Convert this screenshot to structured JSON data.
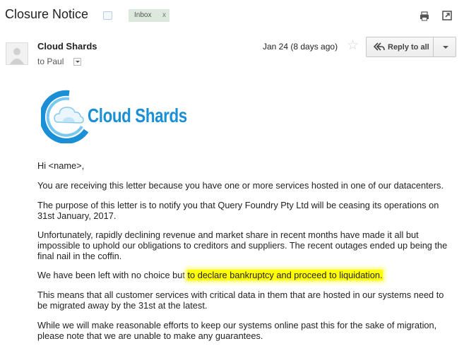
{
  "subject": "Closure Notice",
  "labels": {
    "inbox": "Inbox",
    "remove": "x"
  },
  "sender": {
    "name": "Cloud Shards",
    "to": "to Paul"
  },
  "date": "Jan 24 (8 days ago)",
  "star": "☆",
  "actions": {
    "reply_all": "Reply to all"
  },
  "logo": {
    "text": "Cloud Shards",
    "accent_color": "#1a8fd6"
  },
  "body": {
    "greeting": "Hi <name>,",
    "p1": "You are receiving this letter because you have one or more services hosted in one of our datacenters.",
    "p2": "The purpose of this letter is to notify you that Query Foundry Pty Ltd will be ceasing its operations on 31st January, 2017.",
    "p3": "Unfortunately, rapidly declining revenue and market share in recent months have made it all but impossible to uphold our obligations to creditors and suppliers. The recent outages ended up being the final nail in the coffin.",
    "p4_pre": "We have been left with no choice but ",
    "p4_highlight": "to declare bankruptcy and proceed to liquidation.",
    "p5": "This means that all customer services with critical data in them that are hosted in our systems need to be migrated away by the 31st at the latest.",
    "p6": "While we will make reasonable efforts to keep our systems online past this for the sake of migration, please note that we are unable to make any guarantees."
  },
  "highlight_color": "#ffff00"
}
